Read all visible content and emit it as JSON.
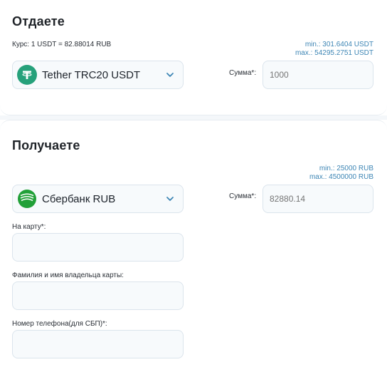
{
  "give": {
    "title": "Отдаете",
    "rate": "Курс: 1 USDT = 82.88014 RUB",
    "min": "min.: 301.6404 USDT",
    "max": "max.: 54295.2751 USDT",
    "currency": {
      "name": "Tether TRC20 USDT",
      "icon": "tether-icon"
    },
    "sum_label": "Сумма*:",
    "sum_value": "1000"
  },
  "get": {
    "title": "Получаете",
    "min": "min.: 25000 RUB",
    "max": "max.: 4500000 RUB",
    "currency": {
      "name": "Сбербанк RUB",
      "icon": "sberbank-icon"
    },
    "sum_label": "Сумма*:",
    "sum_value": "82880.14",
    "fields": [
      {
        "label": "На карту*:",
        "value": ""
      },
      {
        "label": "Фамилия и имя владельца карты:",
        "value": ""
      },
      {
        "label": "Номер телефона(для СБП)*:",
        "value": ""
      }
    ]
  },
  "colors": {
    "accent": "#3e86b5",
    "tether": "#26a17b",
    "sber": "#21a038",
    "input_bg": "#f7fafc",
    "input_border": "#dbe4ec"
  }
}
